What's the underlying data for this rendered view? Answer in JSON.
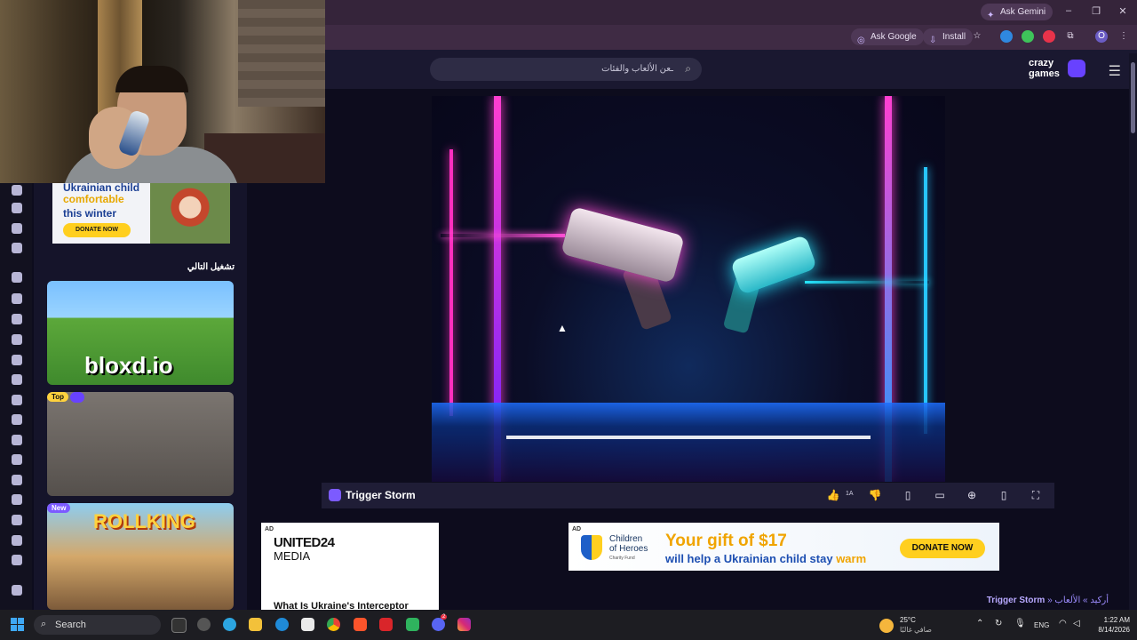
{
  "browser": {
    "ask_gemini": "Ask Gemini",
    "ask_google": "Ask Google",
    "install": "Install",
    "window_controls": [
      "–",
      "❐",
      "✕"
    ],
    "extension_icons": [
      "globe-icon",
      "leaf-icon",
      "flame-icon",
      "puzzle-icon"
    ],
    "profile_initial": "O"
  },
  "site": {
    "search_placeholder": "ـعن الألعاب والفئات",
    "logo_line1": "crazy",
    "logo_line2": "games",
    "continue_playing": "تشغيل التالي"
  },
  "left_ad": {
    "line1": "Ukrainian child",
    "line2": "comfortable",
    "line3": "this winter",
    "button": "DONATE NOW"
  },
  "games": [
    {
      "title": "bloxd.io",
      "badge": ""
    },
    {
      "title": "",
      "badge": "Top"
    },
    {
      "title": "ROLLKING",
      "badge": "New"
    }
  ],
  "game_bar": {
    "title": "Trigger Storm",
    "likes": "1A",
    "buttons": [
      "like-icon",
      "dislike-icon",
      "bookmark-icon",
      "feedback-icon",
      "theater-icon",
      "mobile-icon",
      "fullscreen-icon"
    ]
  },
  "ads": {
    "label": "AD",
    "united24_head": "UNITED24",
    "united24_sub": "MEDIA",
    "united24_question": "What Is Ukraine's Interceptor",
    "org_line1": "Children",
    "org_line2": "of Heroes",
    "org_line3": "Charity Fund",
    "gift_line": "Your gift of $17",
    "help_line_start": "will help a Ukrainian child stay",
    "help_line_end": "warm",
    "donate": "DONATE NOW"
  },
  "breadcrumb": {
    "root": "الألعاب",
    "sep1": "»",
    "category": "أركيد",
    "sep2": "»",
    "current": "Trigger Storm"
  },
  "taskbar": {
    "search": "Search",
    "temperature": "25°C",
    "weather_desc": "صافي غالبًا",
    "language": "ENG",
    "time": "1:22 AM",
    "date": "8/14/2026",
    "discord_badge": "2"
  },
  "colors": {
    "accent": "#6842ff",
    "background": "#0d0c1d",
    "donate_yellow": "#ffcf1f"
  }
}
